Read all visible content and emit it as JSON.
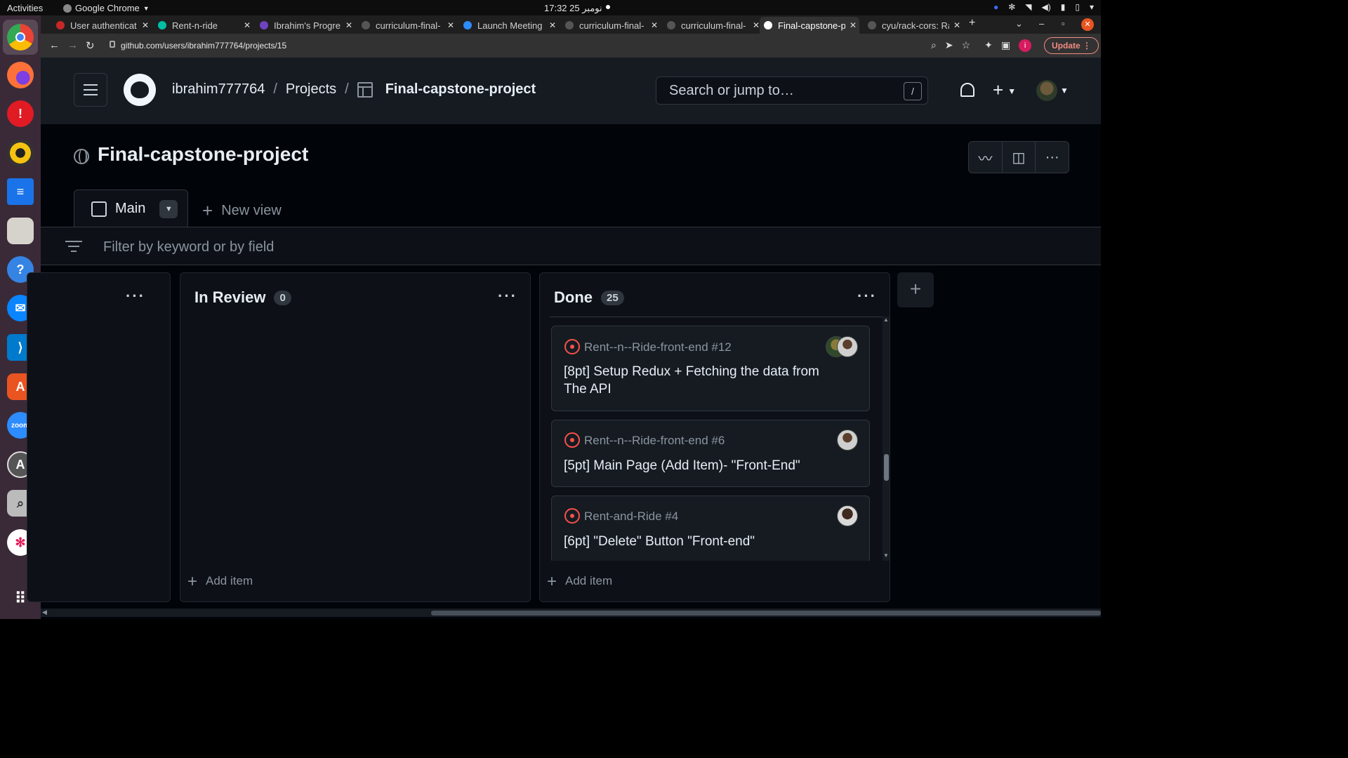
{
  "os": {
    "activities": "Activities",
    "app_name": "Google Chrome",
    "clock": "17:32  25 نومبر"
  },
  "dock": {
    "apps": [
      "chrome-icon",
      "firefox-icon",
      "alert-icon",
      "rhythmbox-icon",
      "writer-icon",
      "files-icon",
      "help-icon",
      "thunderbird-icon",
      "vscode-icon",
      "app-center-icon",
      "zoom-icon",
      "updater-icon",
      "search-icon",
      "slack-icon",
      "app-grid-icon"
    ],
    "zoom_label": "zoom"
  },
  "browser": {
    "tabs": [
      {
        "title": "User authenticat",
        "color": "#c62828"
      },
      {
        "title": "Rent-n-ride",
        "color": "#00bfa5"
      },
      {
        "title": "Ibrahim's Progre",
        "color": "#6f42c1"
      },
      {
        "title": "curriculum-final-",
        "color": "#555555"
      },
      {
        "title": "Launch Meeting",
        "color": "#2d8cff"
      },
      {
        "title": "curriculum-final-",
        "color": "#555555"
      },
      {
        "title": "curriculum-final-",
        "color": "#555555"
      },
      {
        "title": "Final-capstone-p",
        "color": "#ffffff"
      },
      {
        "title": "cyu/rack-cors: Ra",
        "color": "#555555"
      }
    ],
    "url": "github.com/users/ibrahim777764/projects/15",
    "profile_initial": "i",
    "update_label": "Update"
  },
  "github": {
    "user": "ibrahim777764",
    "projects_link": "Projects",
    "project_name": "Final-capstone-project",
    "search_placeholder": "Search or jump to…",
    "search_shortcut": "/"
  },
  "project": {
    "title": "Final-capstone-project",
    "view_tab": "Main",
    "new_view": "New view",
    "filter_placeholder": "Filter by keyword or by field",
    "columns": [
      {
        "name": "In Review",
        "count": "0",
        "add_item": "Add item"
      },
      {
        "name": "Done",
        "count": "25",
        "add_item": "Add item"
      }
    ],
    "cards": [
      {
        "repo": "Rent--n--Ride-front-end #12",
        "title": "[8pt] Setup Redux + Fetching the data from The API",
        "avatars": 2
      },
      {
        "repo": "Rent--n--Ride-front-end #6",
        "title": "[5pt] Main Page (Add Item)- \"Front-End\"",
        "avatars": 1
      },
      {
        "repo": "Rent-and-Ride #4",
        "title": "[6pt] \"Delete\" Button \"Front-end\"",
        "avatars": 1
      }
    ]
  },
  "colors": {
    "bg": "#010409",
    "header": "#161b22",
    "border": "#30363d",
    "issue_open": "#f85149"
  }
}
